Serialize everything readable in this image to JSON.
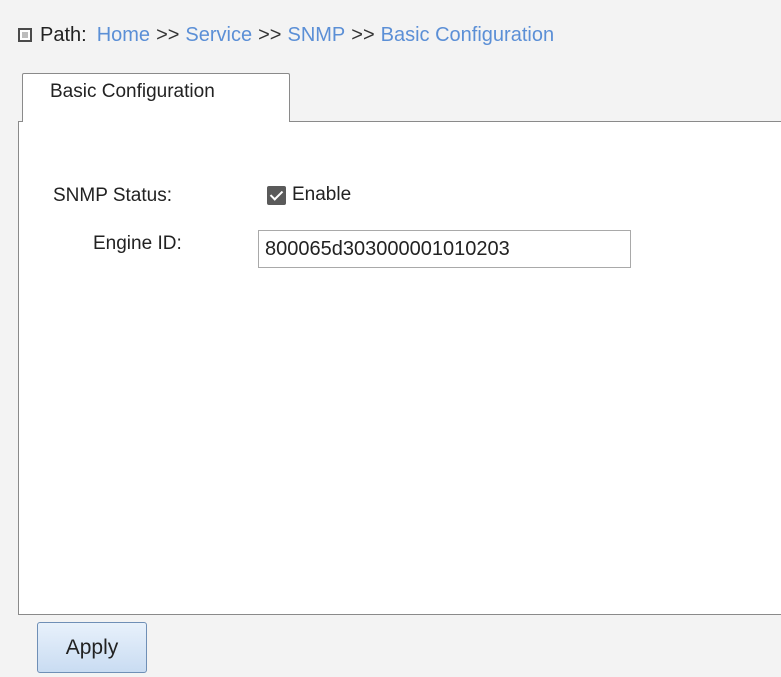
{
  "breadcrumb": {
    "icon": "square-icon",
    "label": "Path:",
    "items": [
      "Home",
      "Service",
      "SNMP",
      "Basic Configuration"
    ],
    "separator": ">>"
  },
  "tab": {
    "label": "Basic Configuration"
  },
  "form": {
    "snmp_status_label": "SNMP Status:",
    "enable_label": "Enable",
    "enable_checked": true,
    "engine_id_label": "Engine ID:",
    "engine_id_value": "800065d303000001010203"
  },
  "actions": {
    "apply_label": "Apply"
  },
  "colors": {
    "link": "#5b8fd6",
    "background": "#f3f3f3",
    "panel": "#ffffff",
    "button_top": "#e8f1fb",
    "button_bottom": "#c9dcf2"
  }
}
